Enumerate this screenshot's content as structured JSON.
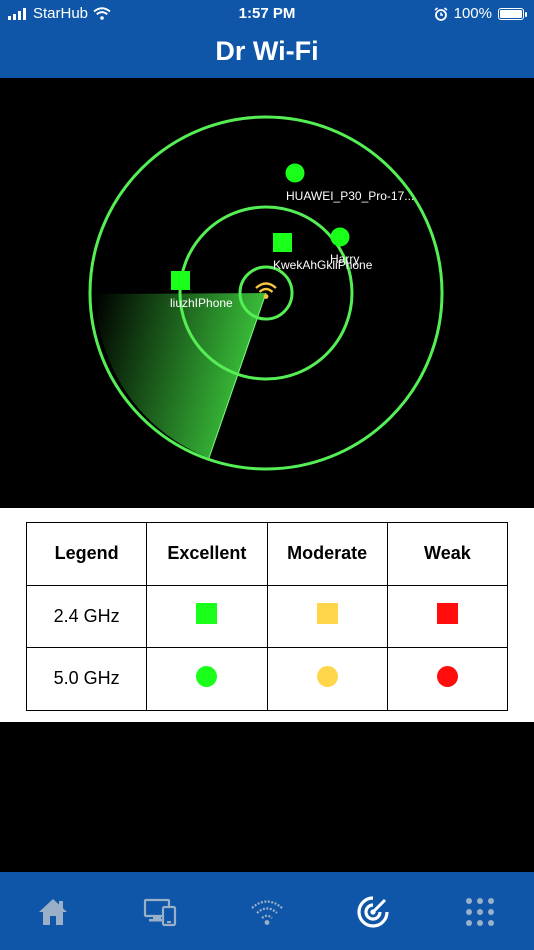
{
  "status": {
    "carrier": "StarHub",
    "time": "1:57 PM",
    "battery": "100%"
  },
  "header": {
    "title": "Dr Wi-Fi"
  },
  "radar": {
    "devices": [
      {
        "label": "HUAWEI_P30_Pro-17...",
        "band": "5.0 GHz",
        "quality": "Excellent"
      },
      {
        "label": "Harry",
        "band": "5.0 GHz",
        "quality": "Excellent"
      },
      {
        "label": "KwekAhGkliPhone",
        "band": "2.4 GHz",
        "quality": "Excellent"
      },
      {
        "label": "liuzhIPhone",
        "band": "2.4 GHz",
        "quality": "Excellent"
      }
    ],
    "colors": {
      "ring": "#55ef55",
      "sweep": "#3fd23f",
      "router": "#f5c542"
    }
  },
  "legend": {
    "headers": [
      "Legend",
      "Excellent",
      "Moderate",
      "Weak"
    ],
    "rows": [
      {
        "label": "2.4 GHz",
        "shape": "square"
      },
      {
        "label": "5.0 GHz",
        "shape": "circle"
      }
    ],
    "colors": {
      "excellent": "#1aff1a",
      "moderate": "#ffd54a",
      "weak": "#ff0d0d"
    }
  },
  "tabs": [
    {
      "icon": "home-icon",
      "active": false
    },
    {
      "icon": "devices-icon",
      "active": false
    },
    {
      "icon": "wifi-icon",
      "active": false
    },
    {
      "icon": "radar-icon",
      "active": true
    },
    {
      "icon": "grid-icon",
      "active": false
    }
  ],
  "theme": {
    "primary": "#0f56a8"
  }
}
